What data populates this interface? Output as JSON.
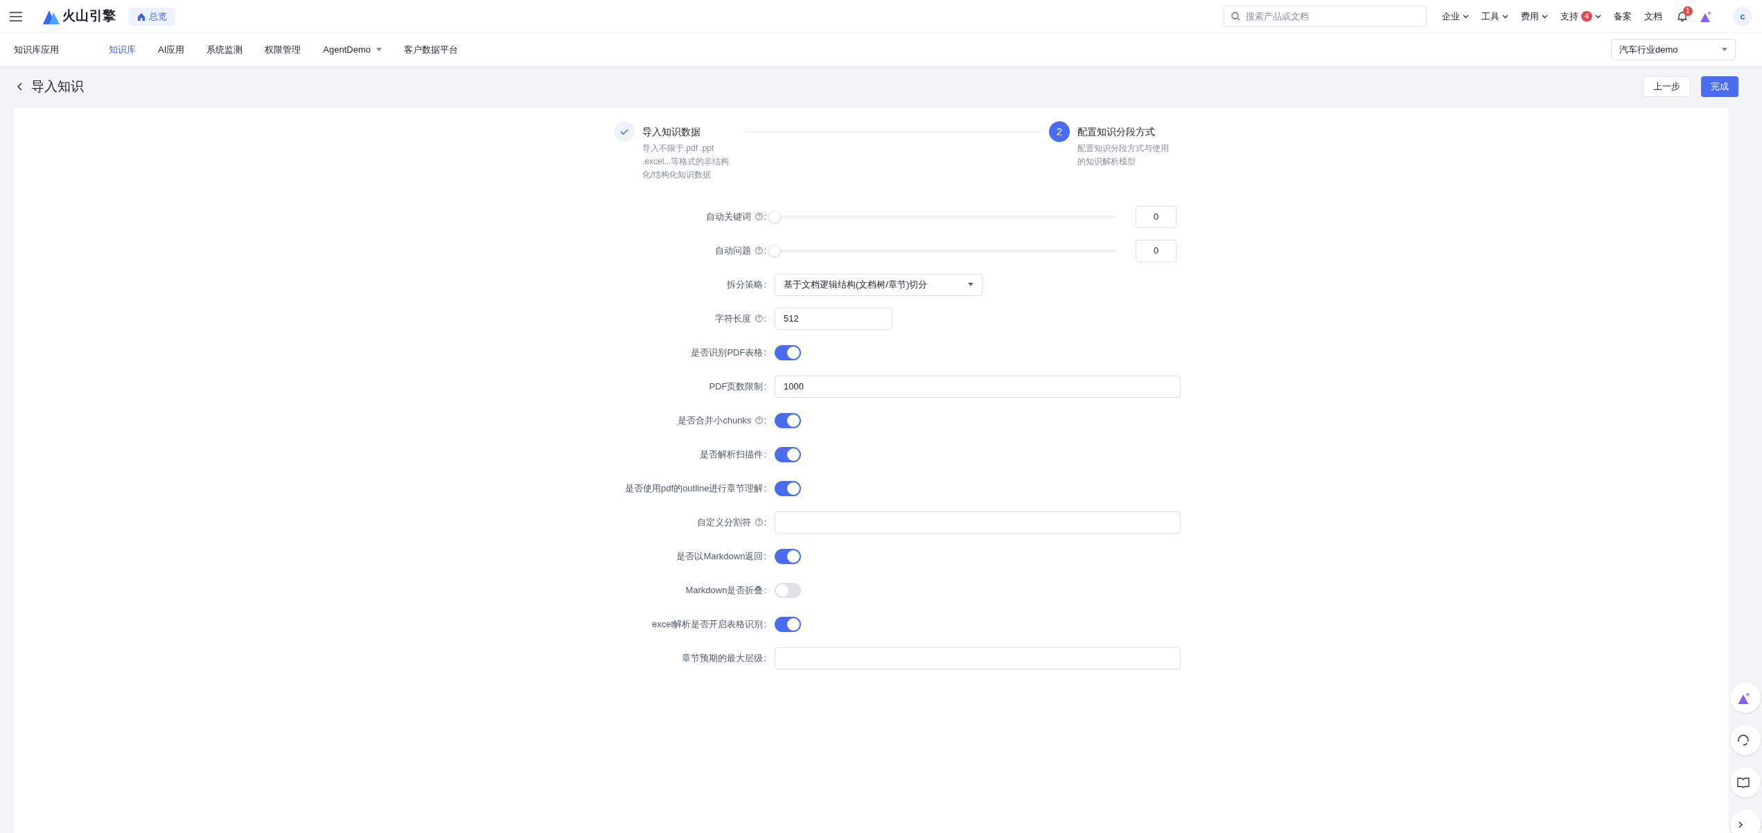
{
  "topbar": {
    "brand": "火山引擎",
    "home_chip": "总览",
    "search": {
      "placeholder": "搜索产品或文档"
    },
    "menus": [
      {
        "label": "企业",
        "dropdown": true
      },
      {
        "label": "工具",
        "dropdown": true
      },
      {
        "label": "费用",
        "dropdown": true
      },
      {
        "label": "支持",
        "dropdown": true,
        "badge": "4"
      },
      {
        "label": "备案",
        "dropdown": false
      },
      {
        "label": "文档",
        "dropdown": false
      }
    ],
    "notification_badge": "1",
    "avatar": "c"
  },
  "nav": {
    "app_title": "知识库应用",
    "tabs": [
      {
        "label": "知识库",
        "selected": true,
        "dropdown": false
      },
      {
        "label": "AI应用",
        "selected": false,
        "dropdown": false
      },
      {
        "label": "系统监测",
        "selected": false,
        "dropdown": false
      },
      {
        "label": "权限管理",
        "selected": false,
        "dropdown": false
      },
      {
        "label": "AgentDemo",
        "selected": false,
        "dropdown": true
      },
      {
        "label": "客户数据平台",
        "selected": false,
        "dropdown": false
      }
    ],
    "project_select": "汽车行业demo"
  },
  "header": {
    "title": "导入知识",
    "buttons": [
      {
        "label": "上一步",
        "kind": "secondary"
      },
      {
        "label": "完成",
        "kind": "primary"
      }
    ]
  },
  "steps": [
    {
      "kind": "done",
      "title": "导入知识数据",
      "description": "导入不限于.pdf .ppt .excel...等格式的非结构化/结构化知识数据"
    },
    {
      "kind": "current",
      "number": "2",
      "title": "配置知识分段方式",
      "description": "配置知识分段方式与使用的知识解析模型"
    }
  ],
  "fields": [
    {
      "kind": "slider",
      "label": "自动关键词",
      "help": true,
      "colon": ":",
      "level": 0,
      "value": "0"
    },
    {
      "kind": "slider",
      "label": "自动问题",
      "help": true,
      "colon": ":",
      "level": 0,
      "value": "0"
    },
    {
      "kind": "select",
      "label": "拆分策略",
      "help": false,
      "colon": ":",
      "value": "基于文档逻辑结构(文档树/章节)切分"
    },
    {
      "kind": "short_input",
      "label": "字符长度",
      "help": true,
      "colon": ":",
      "value": "512"
    },
    {
      "kind": "switch",
      "label": "是否识别PDF表格",
      "help": false,
      "colon": ":",
      "on": true
    },
    {
      "kind": "input",
      "label": "PDF页数限制",
      "help": false,
      "colon": ":",
      "value": "1000"
    },
    {
      "kind": "switch",
      "label": "是否合并小chunks",
      "help": true,
      "colon": ":",
      "on": true
    },
    {
      "kind": "switch",
      "label": "是否解析扫描件",
      "help": false,
      "colon": ":",
      "on": true
    },
    {
      "kind": "switch",
      "label": "是否使用pdf的outline进行章节理解",
      "help": false,
      "colon": ":",
      "on": true
    },
    {
      "kind": "input",
      "label": "自定义分割符",
      "help": true,
      "colon": ":"
    },
    {
      "kind": "switch",
      "label": "是否以Markdown返回",
      "help": false,
      "colon": ":",
      "on": true
    },
    {
      "kind": "switch",
      "label": "Markdown是否折叠",
      "help": false,
      "colon": ":",
      "on": false
    },
    {
      "kind": "switch",
      "label": "excel解析是否开启表格识别",
      "help": false,
      "colon": ":",
      "on": true
    },
    {
      "kind": "input",
      "label": "章节预期的最大层级",
      "help": false,
      "colon": ":"
    }
  ]
}
